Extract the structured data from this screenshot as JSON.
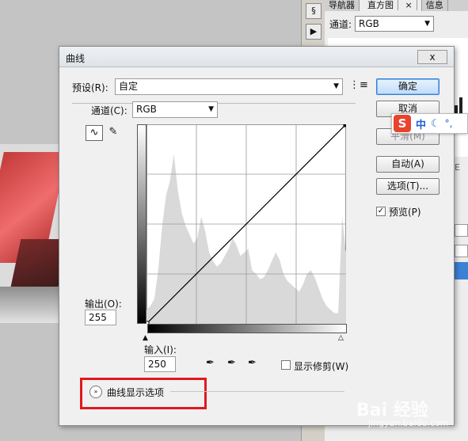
{
  "dialog": {
    "title": "曲线",
    "close_label": "x",
    "preset_label": "预设(R):",
    "preset_value": "自定",
    "channel_label": "通道(C):",
    "channel_value": "RGB",
    "output_label": "输出(O):",
    "output_value": "255",
    "input_label": "输入(I):",
    "input_value": "250",
    "show_clipping_label": "显示修剪(W)",
    "curve_options_label": "曲线显示选项",
    "preview_label": "预览(P)",
    "preview_checked": true,
    "buttons": {
      "ok": "确定",
      "cancel": "取消",
      "smooth": "平滑(M)",
      "auto": "自动(A)",
      "options": "选项(T)..."
    }
  },
  "panel": {
    "tabs": [
      "导航器",
      "直方图",
      "信息"
    ],
    "tab_close": "×",
    "channel_label": "通道:",
    "channel_value": "RGB",
    "cut_text": "E"
  },
  "ime": {
    "logo": "S",
    "lang": "中",
    "moon": "☾",
    "punct": "°,"
  },
  "watermark": {
    "text": "Bai 经验",
    "sub": "jingyan.baidu.com"
  },
  "chart_data": {
    "type": "area",
    "title": "",
    "xlim": [
      0,
      255
    ],
    "ylim": [
      0,
      255
    ],
    "grid": "4x4",
    "histogram_color": "#d9d9d9",
    "histogram": [
      8,
      10,
      14,
      30,
      55,
      72,
      80,
      95,
      75,
      62,
      55,
      50,
      45,
      48,
      60,
      52,
      40,
      35,
      32,
      34,
      38,
      42,
      48,
      44,
      38,
      40,
      42,
      30,
      28,
      25,
      26,
      30,
      35,
      40,
      36,
      28,
      24,
      22,
      20,
      18,
      22,
      28,
      30,
      26,
      20,
      14,
      10,
      8,
      6,
      6,
      60,
      40
    ],
    "curve": {
      "x": [
        0,
        255
      ],
      "y": [
        0,
        255
      ]
    }
  }
}
